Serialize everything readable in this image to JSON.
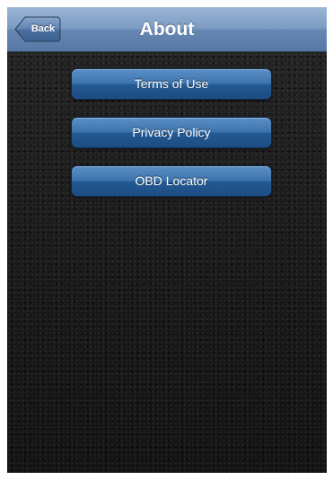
{
  "nav": {
    "title": "About",
    "back_label": "Back"
  },
  "menu": {
    "items": [
      {
        "label": "Terms of Use"
      },
      {
        "label": "Privacy Policy"
      },
      {
        "label": "OBD Locator"
      }
    ]
  },
  "colors": {
    "nav_bar": "#7b9bc2",
    "button": "#2e6aa6",
    "background": "#1a1a1a"
  }
}
